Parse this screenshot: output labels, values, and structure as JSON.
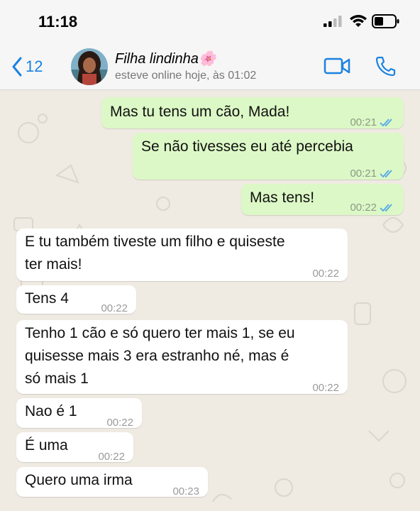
{
  "status": {
    "time": "11:18"
  },
  "header": {
    "back_count": "12",
    "contact_name": "Filha lindinha🌸",
    "contact_status": "esteve online hoje, às 01:02"
  },
  "messages": [
    {
      "dir": "out",
      "text": "Mas tu tens um cão, Mada!",
      "time": "00:21",
      "read": true
    },
    {
      "dir": "out",
      "text": "Se não tivesses eu até percebia",
      "time": "00:21",
      "read": true
    },
    {
      "dir": "out",
      "text": "Mas tens!",
      "time": "00:22",
      "read": true
    },
    {
      "dir": "in",
      "lines": [
        "E tu também tiveste um filho e quiseste",
        "ter mais!"
      ],
      "time": "00:22"
    },
    {
      "dir": "in",
      "text": "Tens 4",
      "time": "00:22"
    },
    {
      "dir": "in",
      "lines": [
        "Tenho  1 cão e só quero ter mais 1, se eu",
        "quisesse mais 3 era estranho né, mas é",
        "só mais 1"
      ],
      "time": "00:22"
    },
    {
      "dir": "in",
      "text": "Nao é 1",
      "time": "00:22"
    },
    {
      "dir": "in",
      "text": "É uma",
      "time": "00:22"
    },
    {
      "dir": "in",
      "text": "Quero uma irma",
      "time": "00:23"
    }
  ],
  "colors": {
    "accent": "#1a82e0",
    "outgoing": "#dcf8c6",
    "incoming": "#ffffff",
    "read_ticks": "#53a8e8"
  }
}
